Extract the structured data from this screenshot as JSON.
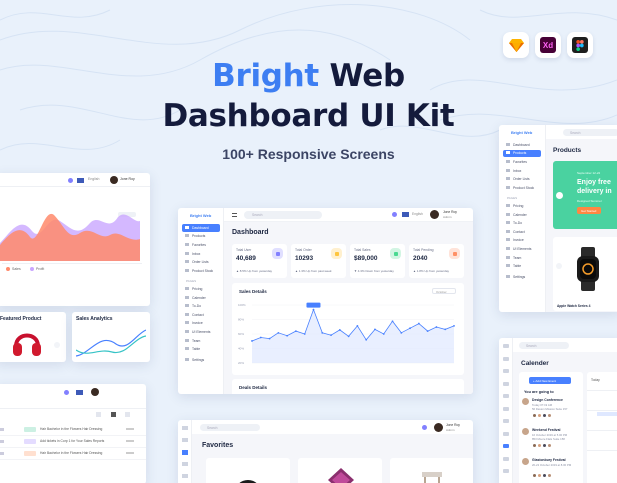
{
  "hero": {
    "title_accent": "Bright",
    "title_rest": " Web",
    "title_line2": "Dashboard UI Kit",
    "subtitle": "100+ Responsive Screens"
  },
  "tools": [
    {
      "icon": "sketch-icon",
      "color": "#f7b500"
    },
    {
      "icon": "xd-icon",
      "label": "Xd",
      "color": "#470137"
    },
    {
      "icon": "figma-icon",
      "color": "#1e1e1e"
    }
  ],
  "main": {
    "logo": "Bright Web",
    "search_placeholder": "Search",
    "language": "English",
    "user": {
      "name": "Jone Roy",
      "role": "Admin"
    },
    "title": "Dashboard",
    "nav": [
      "Dashboard",
      "Products",
      "Favorites",
      "Inbox",
      "Order Lists",
      "Product Stock"
    ],
    "pages_heading": "PAGES",
    "pages": [
      "Pricing",
      "Calender",
      "To-Do",
      "Contact",
      "Invoice",
      "UI Elements",
      "Team",
      "Table"
    ],
    "settings": "Settings",
    "stats": [
      {
        "label": "Total User",
        "value": "40,689",
        "change": "8.5% Up from yesterday",
        "color": "#8280ff"
      },
      {
        "label": "Total Order",
        "value": "10293",
        "change": "1.3% Up from past week",
        "color": "#fec53d"
      },
      {
        "label": "Total Sales",
        "value": "$89,000",
        "change": "4.3% Down from yesterday",
        "color": "#4ad991"
      },
      {
        "label": "Total Pending",
        "value": "2040",
        "change": "1.8% Up from yesterday",
        "color": "#ff9066"
      }
    ],
    "sales_title": "Sales Details",
    "month": "October",
    "deals_title": "Deals Details",
    "chart_data": {
      "type": "area",
      "y": [
        38,
        44,
        42,
        52,
        47,
        55,
        50,
        92,
        52,
        48,
        57,
        46,
        64,
        40,
        58,
        50,
        72,
        52,
        60,
        68,
        55,
        62,
        58,
        64
      ],
      "ylim": [
        0,
        100
      ],
      "tick_labels": [
        "100%",
        "80%",
        "60%",
        "40%",
        "20%"
      ]
    }
  },
  "left_top": {
    "language": "English",
    "user": "Jone Roy",
    "legend": [
      "Sales",
      "Profit"
    ],
    "featured": "Featured Product",
    "analytics": "Sales Analytics"
  },
  "left_bottom": {
    "rows": [
      "Hair Bachelor in the Flowers Hair Dressing",
      "Add tickets in Corp 1 for Your Sales Reports",
      "Hair Bachelor in the Flowers Hair Dressing"
    ]
  },
  "right_top": {
    "logo": "Bright Web",
    "search": "Search",
    "title": "Products",
    "nav": [
      "Dashboard",
      "Products",
      "Favorites",
      "Inbox",
      "Order Lists",
      "Product Stock"
    ],
    "pages_heading": "PAGES",
    "pages": [
      "Pricing",
      "Calender",
      "To-Do",
      "Contact",
      "Invoice",
      "UI Elements",
      "Team",
      "Table"
    ],
    "settings": "Settings",
    "promo_date": "September 12-22",
    "promo_line1": "Enjoy free",
    "promo_line2": "delivery in",
    "promo_sub": "Designed Summer",
    "promo_button": "Get Started",
    "product_name": "Apple Watch Series 4"
  },
  "right_bottom": {
    "search": "Search",
    "title": "Calender",
    "add_button": "+ Add New Event",
    "going": "You are going to",
    "today": "Today",
    "events": [
      {
        "title": "Design Conference",
        "time": "Today 07:19 AM",
        "place": "56 Davion Mission Suite 157"
      },
      {
        "title": "Weekend Festival",
        "time": "16 October 2019 at 5.00 PM",
        "place": "853 Moore Flats Suite 158"
      },
      {
        "title": "Glastonbury Festival",
        "time": "20-22 October 2019 at 8.00 PM",
        "place": ""
      }
    ]
  },
  "bottom_center": {
    "search": "Search",
    "title": "Favorites",
    "user": "Jone Roy",
    "role": "Admin"
  }
}
